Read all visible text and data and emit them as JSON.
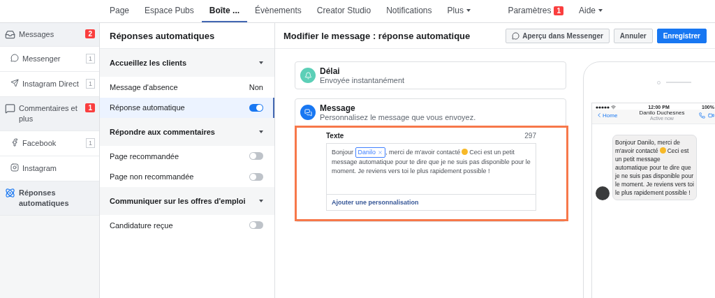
{
  "nav": {
    "tabs": [
      {
        "label": "Page",
        "selected": false,
        "dropdown": false
      },
      {
        "label": "Espace Pubs",
        "selected": false,
        "dropdown": false
      },
      {
        "label": "Boîte ...",
        "selected": true,
        "dropdown": false
      },
      {
        "label": "Évènements",
        "selected": false,
        "dropdown": false
      },
      {
        "label": "Creator Studio",
        "selected": false,
        "dropdown": false
      },
      {
        "label": "Notifications",
        "selected": false,
        "dropdown": false
      },
      {
        "label": "Plus",
        "selected": false,
        "dropdown": true
      }
    ],
    "right": [
      {
        "label": "Paramètres",
        "badge": "1",
        "dropdown": false
      },
      {
        "label": "Aide",
        "dropdown": true
      }
    ]
  },
  "sidebar": {
    "items": [
      {
        "kind": "section",
        "label": "Messages",
        "badge": "2",
        "selected": false
      },
      {
        "kind": "sub",
        "label": "Messenger",
        "count": "1",
        "selected": false
      },
      {
        "kind": "sub",
        "label": "Instagram Direct",
        "count": "1",
        "selected": false
      },
      {
        "kind": "section",
        "label": "Commentaires et plus",
        "badge": "1",
        "selected": false
      },
      {
        "kind": "sub",
        "label": "Facebook",
        "count": "1",
        "selected": false
      },
      {
        "kind": "sub",
        "label": "Instagram",
        "selected": false
      },
      {
        "kind": "section",
        "label": "Réponses automatiques",
        "selected": true
      }
    ]
  },
  "settings": {
    "title": "Réponses automatiques",
    "rows": [
      {
        "kind": "group",
        "label": "Accueillez les clients"
      },
      {
        "kind": "value",
        "label": "Message d'absence",
        "value": "Non",
        "selected": false
      },
      {
        "kind": "toggle",
        "label": "Réponse automatique",
        "on": true,
        "selected": true
      },
      {
        "kind": "group",
        "label": "Répondre aux commentaires"
      },
      {
        "kind": "toggle",
        "label": "Page recommandée",
        "on": false,
        "selected": false
      },
      {
        "kind": "toggle",
        "label": "Page non recommandée",
        "on": false,
        "selected": false
      },
      {
        "kind": "group",
        "label": "Communiquer sur les offres d'emploi"
      },
      {
        "kind": "toggle",
        "label": "Candidature reçue",
        "on": false,
        "selected": false
      }
    ]
  },
  "editor": {
    "title": "Modifier le message : réponse automatique",
    "buttons": [
      {
        "kind": "preview",
        "label": "Aperçu dans Messenger"
      },
      {
        "kind": "plain",
        "label": "Annuler"
      },
      {
        "kind": "primary",
        "label": "Enregistrer"
      }
    ],
    "delay": {
      "title": "Délai",
      "subtitle": "Envoyée instantanément"
    },
    "message": {
      "title": "Message",
      "subtitle": "Personnalisez le message que vous envoyez.",
      "field_label": "Texte",
      "count": "297",
      "text_start": "Bonjour",
      "token": "Danilo",
      "text_before_emoji": ", merci de m'avoir contacté",
      "text_after_emoji": "Ceci est un petit message automatique pour te dire que je ne suis pas disponible pour le moment. Je reviens vers toi le plus rapidement possible !",
      "add_link": "Ajouter une personnalisation"
    }
  },
  "preview": {
    "time": "12:00 PM",
    "battery": "100%",
    "back": "Home",
    "name": "Danilo Duchesnes",
    "status": "Active now",
    "bubble_before_emoji": "Bonjour Danilo, merci de m'avoir contacté",
    "bubble_after_emoji": "Ceci est un petit message automatique pour te dire que je ne suis pas disponible pour le moment. Je reviens vers toi le plus rapidement possible !"
  }
}
